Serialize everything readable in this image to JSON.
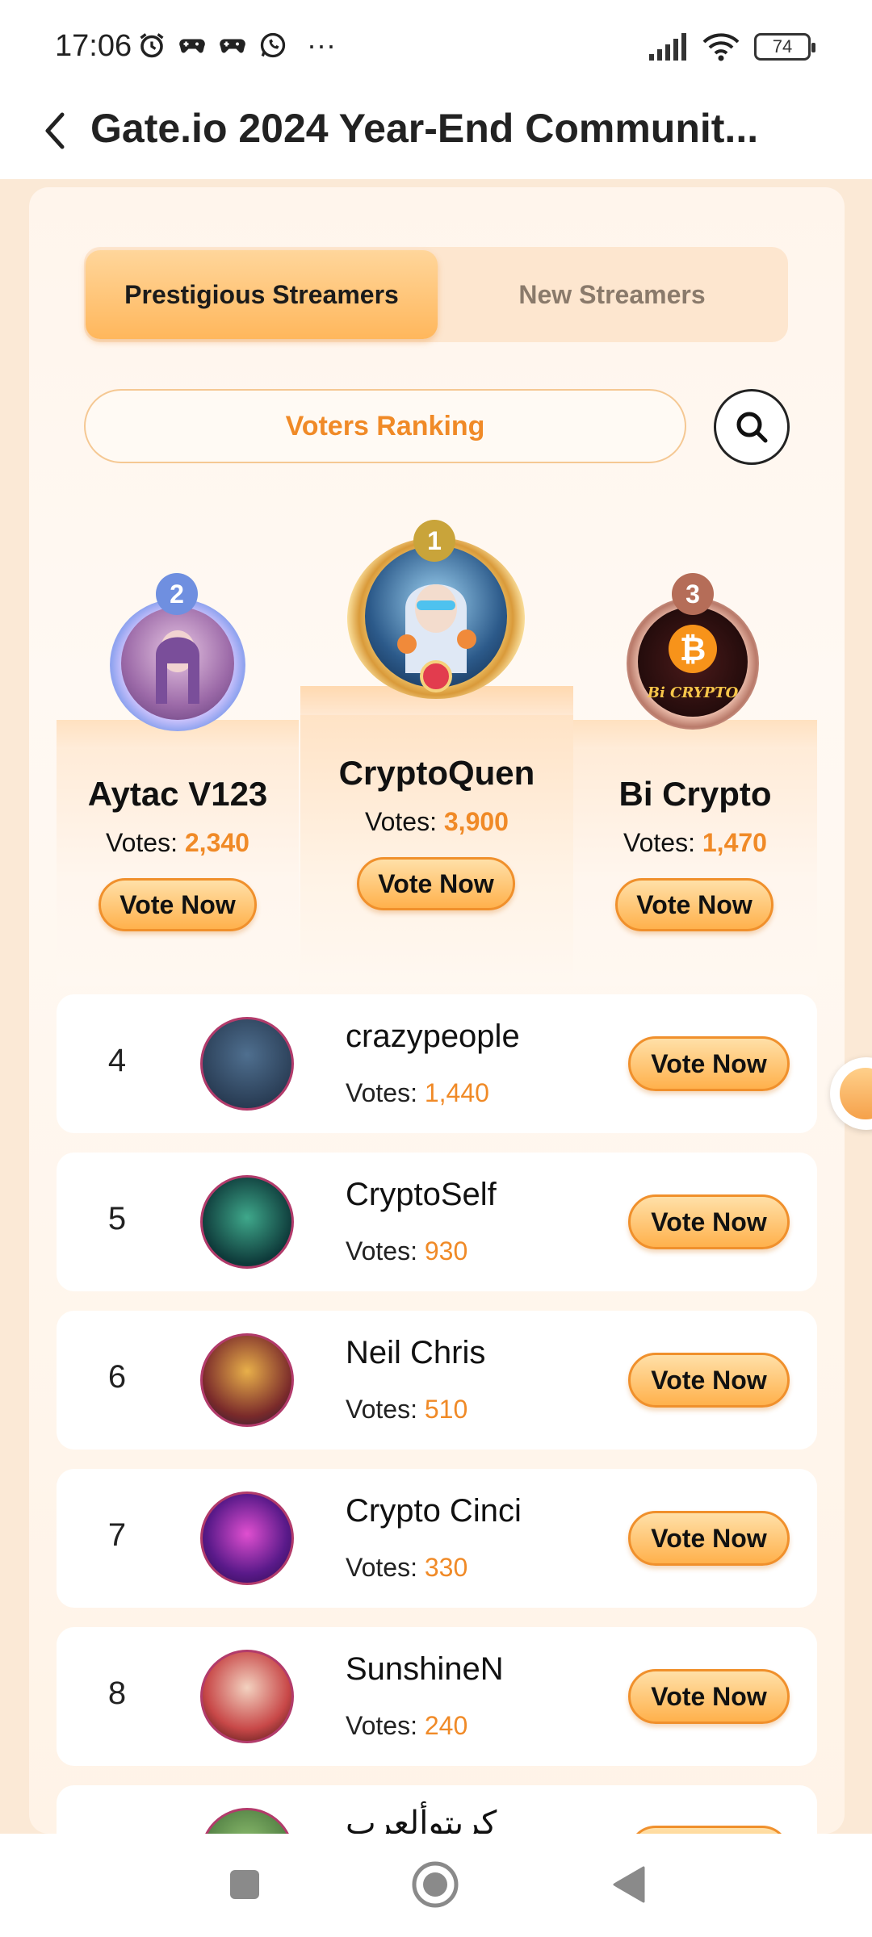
{
  "status": {
    "time": "17:06",
    "battery": "74",
    "more": "···"
  },
  "header": {
    "title": "Gate.io 2024 Year-End Communit..."
  },
  "tabs": [
    {
      "label": "Prestigious Streamers",
      "active": true
    },
    {
      "label": "New Streamers",
      "active": false
    }
  ],
  "voters_ranking": {
    "label": "Voters Ranking"
  },
  "podium": [
    {
      "rank": "2",
      "name": "Aytac V123",
      "votes_label": "Votes: ",
      "votes": "2,340",
      "button": "Vote Now"
    },
    {
      "rank": "1",
      "name": "CryptoQuen",
      "votes_label": "Votes: ",
      "votes": "3,900",
      "button": "Vote Now"
    },
    {
      "rank": "3",
      "name": "Bi Crypto",
      "votes_label": "Votes: ",
      "votes": "1,470",
      "button": "Vote Now"
    }
  ],
  "podium_art": {
    "bi_crypto_text": "Bi CRYPTO"
  },
  "list": [
    {
      "rank": "4",
      "name": "crazypeople",
      "votes_label": "Votes: ",
      "votes": "1,440",
      "button": "Vote Now"
    },
    {
      "rank": "5",
      "name": "CryptoSelf",
      "votes_label": "Votes: ",
      "votes": "930",
      "button": "Vote Now"
    },
    {
      "rank": "6",
      "name": "Neil Chris",
      "votes_label": "Votes: ",
      "votes": "510",
      "button": "Vote Now"
    },
    {
      "rank": "7",
      "name": "Crypto Cinci",
      "votes_label": "Votes: ",
      "votes": "330",
      "button": "Vote Now"
    },
    {
      "rank": "8",
      "name": "SunshineN",
      "votes_label": "Votes: ",
      "votes": "240",
      "button": "Vote Now"
    },
    {
      "rank": "",
      "name": "كريتوألعرب",
      "votes_label": "",
      "votes": "",
      "button": ""
    }
  ],
  "colors": {
    "accent": "#f08a27",
    "button_gradient_top": "#ffe0a8",
    "button_gradient_bottom": "#ffb14c",
    "background": "#fdf1e4"
  }
}
